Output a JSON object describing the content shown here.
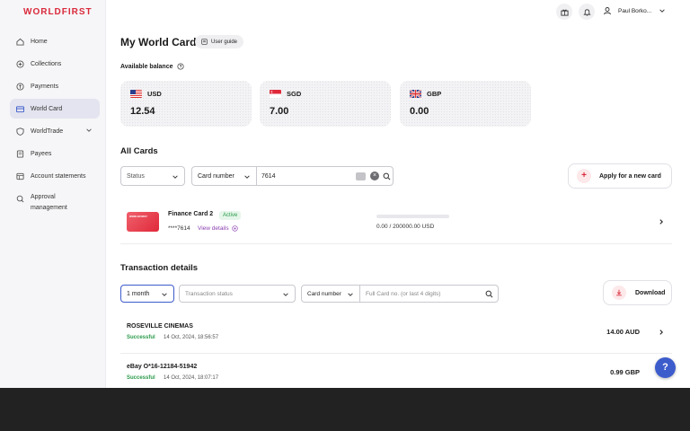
{
  "brand": {
    "logo": "WORLDFIRST",
    "accent": "#d9293a",
    "link": "#3d5ccc"
  },
  "sidebar": {
    "items": [
      {
        "label": "Home",
        "icon": "home-icon"
      },
      {
        "label": "Collections",
        "icon": "collections-icon"
      },
      {
        "label": "Payments",
        "icon": "payments-icon"
      },
      {
        "label": "World Card",
        "icon": "card-icon",
        "active": true
      },
      {
        "label": "WorldTrade",
        "icon": "shield-icon",
        "expandable": true
      },
      {
        "label": "Payees",
        "icon": "payees-icon"
      },
      {
        "label": "Account statements",
        "icon": "statements-icon"
      },
      {
        "label": "Approval",
        "label2": "management",
        "icon": "approval-icon"
      }
    ]
  },
  "header": {
    "user_name": "Paul Borko..."
  },
  "page": {
    "title": "My World Card",
    "user_guide": "User guide"
  },
  "balances": {
    "label": "Available balance",
    "items": [
      {
        "currency": "USD",
        "amount": "12.54"
      },
      {
        "currency": "SGD",
        "amount": "7.00"
      },
      {
        "currency": "GBP",
        "amount": "0.00"
      }
    ]
  },
  "all_cards": {
    "title": "All Cards",
    "status_select": "Status",
    "field_select": "Card number",
    "search_value": "7614",
    "apply_button": "Apply for a new card",
    "cards": [
      {
        "thumb_text": "WORLDFIRST",
        "name": "Finance Card 2",
        "status": "Active",
        "number": "****7614",
        "view_details": "View details",
        "limit_fraction": 0,
        "limit_text": "0.00 / 200000.00 USD"
      }
    ]
  },
  "transactions": {
    "title": "Transaction details",
    "period": "1 month",
    "status_placeholder": "Transaction status",
    "field_select": "Card number",
    "search_placeholder": "Full Card no. (or last 4 digits)",
    "download": "Download",
    "rows": [
      {
        "merchant": "ROSEVILLE CINEMAS",
        "status": "Successful",
        "date": "14 Oct, 2024, 18:56:57",
        "amount": "14.00  AUD"
      },
      {
        "merchant": "eBay O*16-12184-51942",
        "status": "Successful",
        "date": "14 Oct, 2024, 18:07:17",
        "amount": "0.99  GBP"
      }
    ]
  },
  "help": "?"
}
